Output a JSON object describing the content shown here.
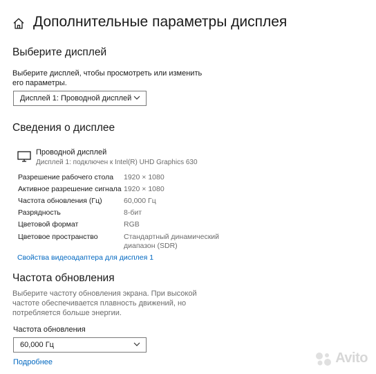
{
  "header": {
    "title": "Дополнительные параметры дисплея"
  },
  "select_display": {
    "heading": "Выберите дисплей",
    "description": "Выберите дисплей, чтобы просмотреть или изменить его параметры.",
    "dropdown_value": "Дисплей 1: Проводной дисплей"
  },
  "display_info": {
    "heading": "Сведения о дисплее",
    "monitor_name": "Проводной дисплей",
    "monitor_subtitle": "Дисплей 1: подключен к Intel(R) UHD Graphics 630",
    "rows": [
      {
        "label": "Разрешение рабочего стола",
        "value": "1920 × 1080"
      },
      {
        "label": "Активное разрешение сигнала",
        "value": "1920 × 1080"
      },
      {
        "label": "Частота обновления (Гц)",
        "value": "60,000 Гц"
      },
      {
        "label": "Разрядность",
        "value": "8-бит"
      },
      {
        "label": "Цветовой формат",
        "value": "RGB"
      },
      {
        "label": "Цветовое пространство",
        "value": "Стандартный динамический диапазон (SDR)"
      }
    ],
    "adapter_link": "Свойства видеоадаптера для дисплея 1"
  },
  "refresh_rate": {
    "heading": "Частота обновления",
    "description": "Выберите частоту обновления экрана. При высокой частоте обеспечивается плавность движений, но потребляется больше энергии.",
    "field_label": "Частота обновления",
    "dropdown_value": "60,000 Гц",
    "more_link": "Подробнее"
  },
  "watermark": {
    "text": "Avito"
  },
  "colors": {
    "link": "#0067c0",
    "muted": "#6b6b6b",
    "border": "#7a7a7a"
  }
}
